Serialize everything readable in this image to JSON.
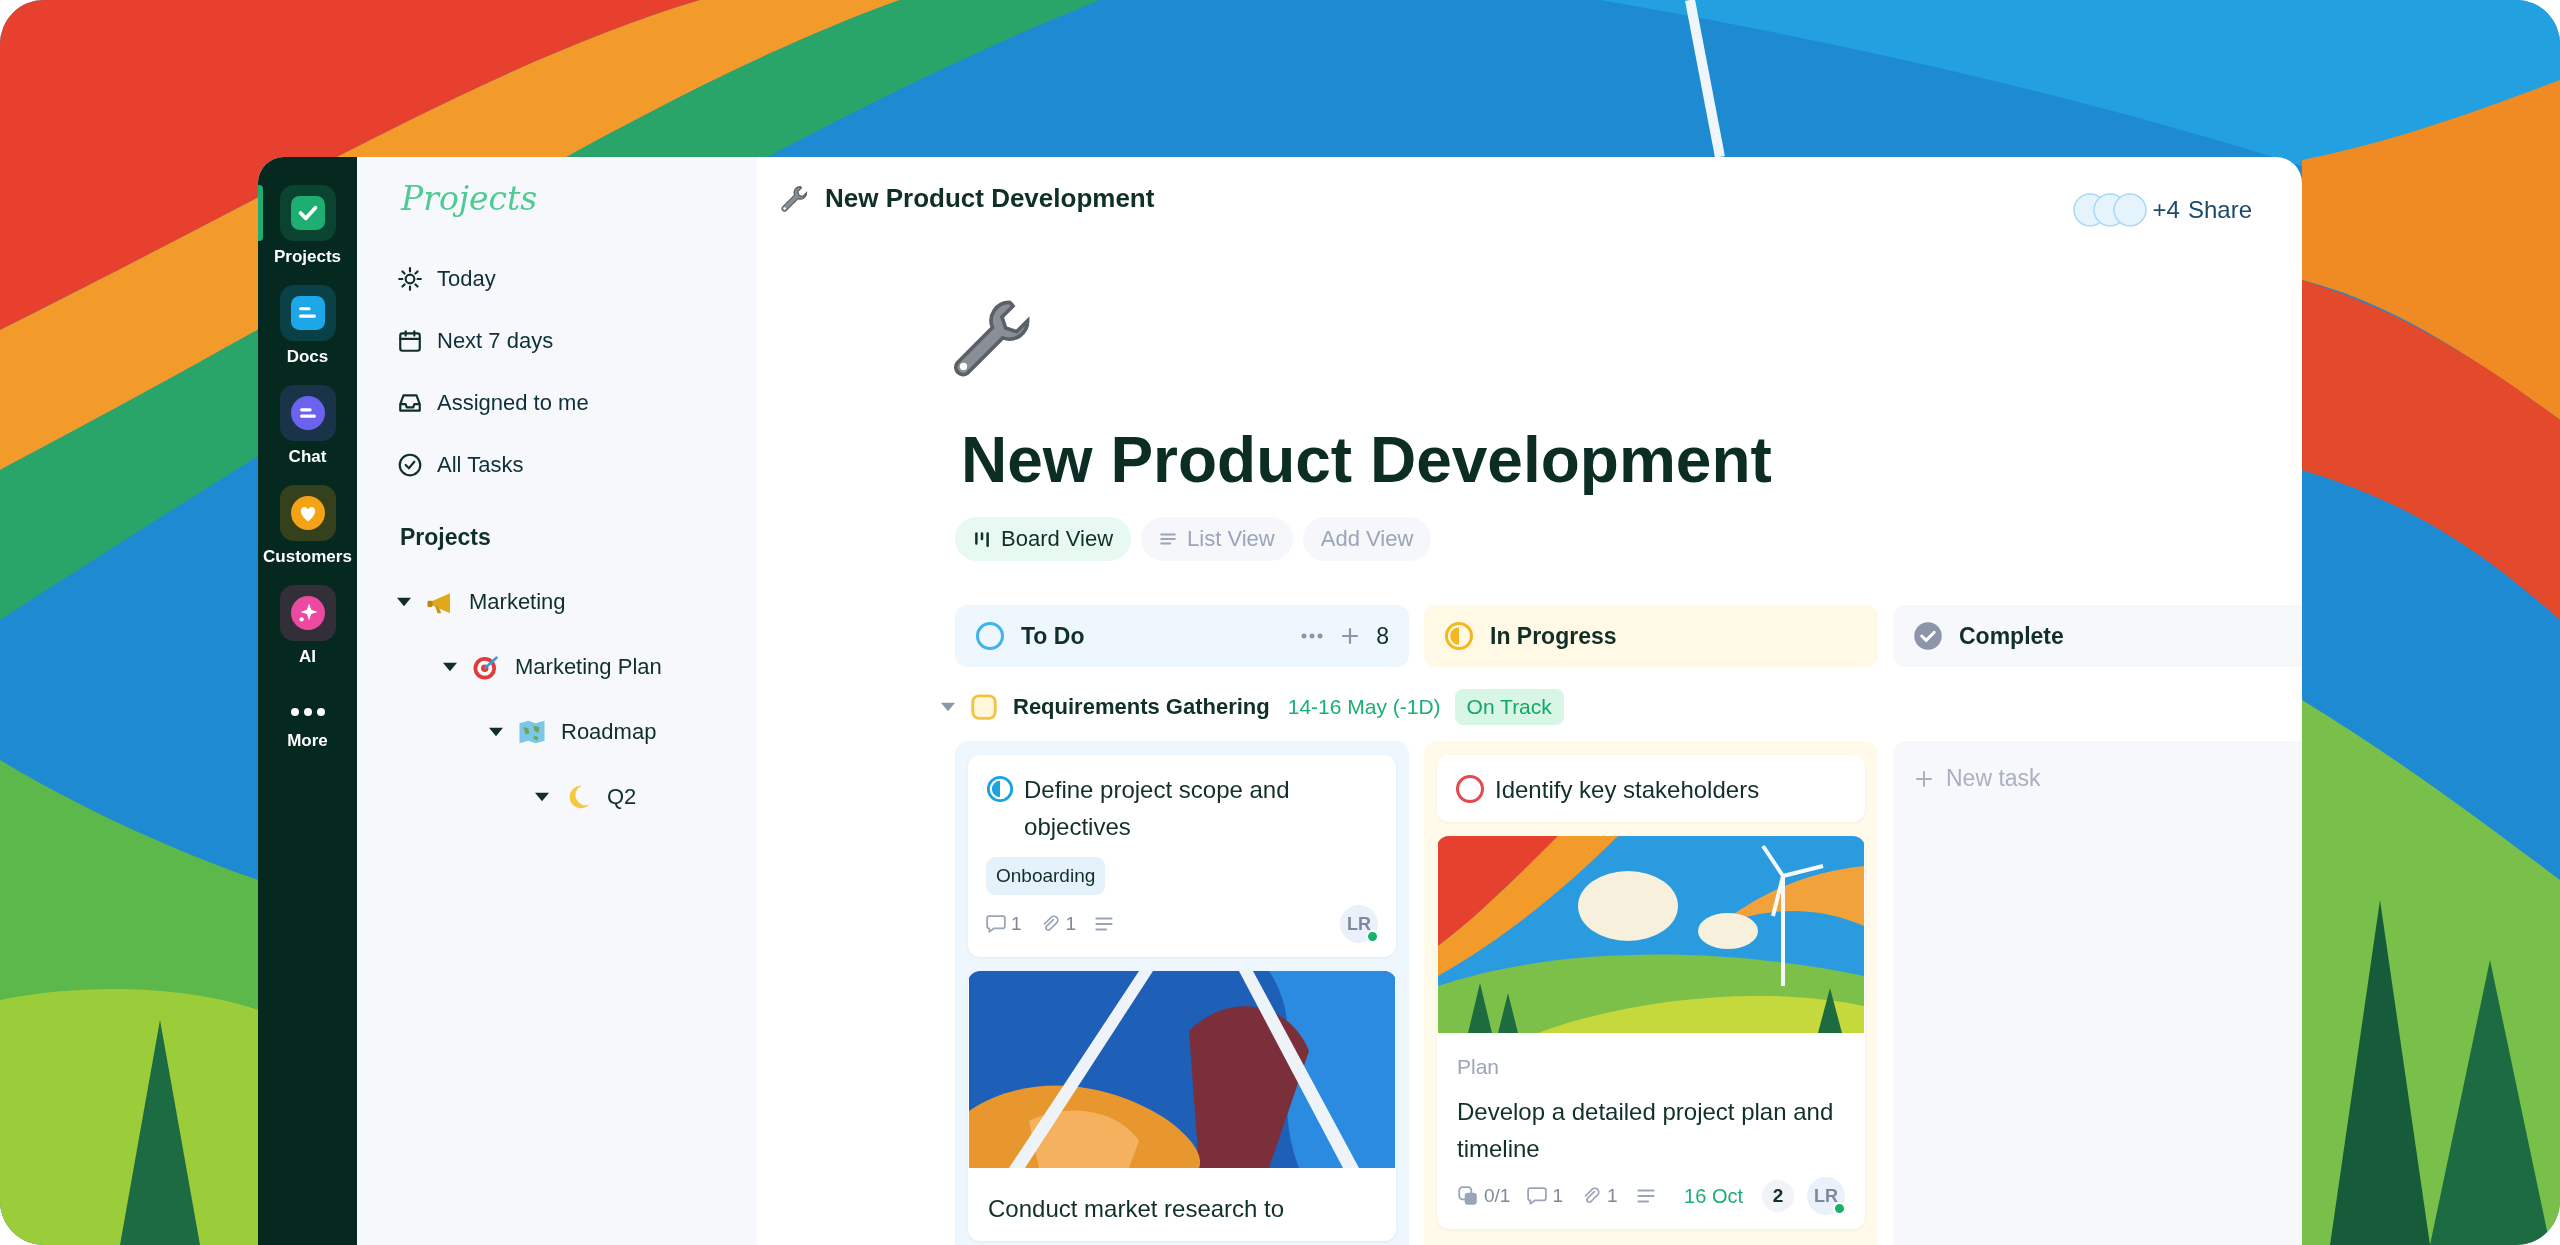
{
  "rail": {
    "items": [
      {
        "label": "Projects",
        "kind": "check",
        "color": "#1fae72",
        "selected": true
      },
      {
        "label": "Docs",
        "kind": "doc",
        "color": "#1ea7e8",
        "selected": false
      },
      {
        "label": "Chat",
        "kind": "chat",
        "color": "#6b63f0",
        "selected": false
      },
      {
        "label": "Customers",
        "kind": "heart",
        "color": "#f5a316",
        "selected": false
      },
      {
        "label": "AI",
        "kind": "sparkle",
        "color": "#ec4aa0",
        "selected": false
      },
      {
        "label": "More",
        "kind": "more",
        "selected": false
      }
    ]
  },
  "sidebar": {
    "title": "Projects",
    "nav": [
      {
        "label": "Today",
        "kind": "sun"
      },
      {
        "label": "Next 7 days",
        "kind": "calendar"
      },
      {
        "label": "Assigned to me",
        "kind": "inbox"
      },
      {
        "label": "All Tasks",
        "kind": "check"
      }
    ],
    "section": "Projects",
    "tree": [
      {
        "label": "Marketing",
        "kind": "megaphone",
        "expanded": true,
        "children": [
          {
            "label": "Marketing Plan",
            "kind": "target",
            "expanded": true,
            "children": [
              {
                "label": "Roadmap",
                "kind": "map",
                "expanded": true,
                "children": [
                  {
                    "label": "Q2",
                    "kind": "moon",
                    "expanded": true
                  }
                ]
              }
            ]
          }
        ]
      }
    ]
  },
  "header": {
    "title": "New Product Development",
    "members": "+4",
    "share": "Share"
  },
  "page": {
    "title": "New Product Development",
    "views": [
      {
        "label": "Board View",
        "kind": "board",
        "selected": true
      },
      {
        "label": "List View",
        "kind": "list",
        "selected": false
      },
      {
        "label": "Add View",
        "kind": "add",
        "selected": false
      }
    ]
  },
  "board": {
    "columns": [
      {
        "name": "To Do",
        "kind": "open",
        "color": "#3fb2ef",
        "count": "8"
      },
      {
        "name": "In Progress",
        "kind": "half",
        "color": "#f5b71f"
      },
      {
        "name": "Complete",
        "kind": "done",
        "color": "#8d96a8"
      }
    ],
    "group": {
      "name": "Requirements Gathering",
      "dates": "14-16 May (-1D)",
      "badge": "On Track",
      "expanded": true
    },
    "lanes": [
      {
        "cards": [
          {
            "title": "Define project scope and objectives",
            "kind": "half",
            "color": "#1aa3e0",
            "tags": [
              "Onboarding"
            ],
            "comments": "1",
            "attachments": "1",
            "description": true,
            "assignee": "LR",
            "online": true
          },
          {
            "cover": true,
            "title": "Conduct market research to"
          }
        ]
      },
      {
        "cards": [
          {
            "title": "Identify key stakeholders",
            "kind": "open",
            "color": "#e5484d"
          },
          {
            "cover": true,
            "list": "Plan",
            "title": "Develop a detailed project plan and timeline",
            "subtasks": "0/1",
            "comments": "1",
            "attachments": "1",
            "description": true,
            "due": "16 Oct",
            "count": "2",
            "assignee": "LR",
            "online": true
          }
        ]
      },
      {
        "new_task": "New task"
      }
    ]
  }
}
